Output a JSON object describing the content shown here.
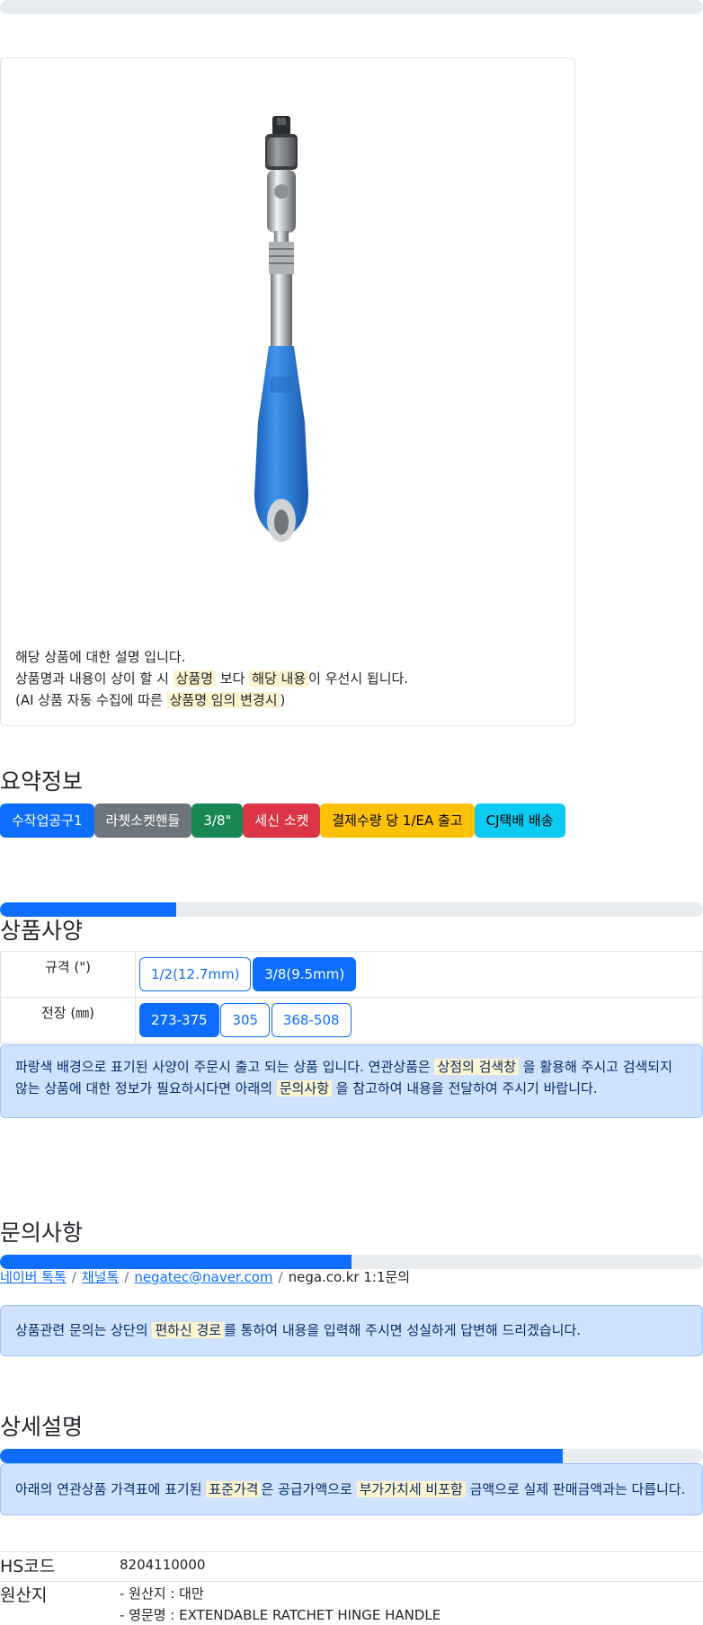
{
  "product": {
    "image_alt": "extendable ratchet hinge handle",
    "description": {
      "line1": "해당 상품에 대한 설명 입니다.",
      "line2_pre": "상품명과 내용이 상이 할 시 ",
      "line2_mark1": "상품명",
      "line2_mid": " 보다 ",
      "line2_mark2": "해당 내용",
      "line2_post": "이 우선시 됩니다.",
      "line3_pre": "(AI 상품 자동 수집에 따른 ",
      "line3_mark": "상품명 임의 변경시",
      "line3_post": ")"
    }
  },
  "summary": {
    "title": "요약정보",
    "badges": [
      {
        "label": "수작업공구1",
        "color": "#0d6efd",
        "text_color": "#ffffff"
      },
      {
        "label": "라쳇소켓핸들",
        "color": "#6c757d",
        "text_color": "#ffffff"
      },
      {
        "label": "3/8\"",
        "color": "#198754",
        "text_color": "#ffffff"
      },
      {
        "label": "세신 소켓",
        "color": "#dc3545",
        "text_color": "#ffffff"
      },
      {
        "label": "결제수량 당 1/EA 출고",
        "color": "#ffc107",
        "text_color": "#000000"
      },
      {
        "label": "CJ택배 배송",
        "color": "#0dcaf0",
        "text_color": "#000000"
      }
    ]
  },
  "spec": {
    "title": "상품사양",
    "progress": 0.25,
    "rows": [
      {
        "label": "규격 (\")",
        "options": [
          {
            "label": "1/2(12.7mm)",
            "selected": false
          },
          {
            "label": "3/8(9.5mm)",
            "selected": true
          }
        ]
      },
      {
        "label": "전장 (㎜)",
        "options": [
          {
            "label": "273-375",
            "selected": true
          },
          {
            "label": "305",
            "selected": false
          },
          {
            "label": "368-508",
            "selected": false
          }
        ]
      }
    ],
    "notice": {
      "pre": "파랑색 배경으로 표기된 사양이 주문시 출고 되는 상품 입니다. 연관상품은 ",
      "mark1": "상점의 검색창",
      "mid": " 을 활용해 주시고 검색되지 않는 상품에 대한 정보가 필요하시다면 아래의 ",
      "mark2": "문의사항",
      "post": " 을 참고하여 내용을 전달하여 주시기 바랍니다."
    }
  },
  "inquiry": {
    "title": "문의사항",
    "progress": 0.5,
    "links": {
      "naver_talk": "네이버 톡톡",
      "channel_talk": "채널톡",
      "email": "negatec@naver.com",
      "site": "nega.co.kr 1:1문의",
      "separator": "/"
    },
    "notice": {
      "pre": "상품관련 문의는 상단의 ",
      "mark": "편하신 경로",
      "post": "를 통하여 내용을 입력해 주시면 성실하게 답변해 드리겠습니다."
    }
  },
  "detail": {
    "title": "상세설명",
    "progress": 0.8,
    "notice": {
      "pre": "아래의 연관상품 가격표에 표기된 ",
      "mark1": "표준가격",
      "mid": "은 공급가액으로 ",
      "mark2": "부가가치세 비포함",
      "post": " 금액으로 실제 판매금액과는 다릅니다."
    },
    "info": [
      {
        "key": "HS코드",
        "values": [
          "8204110000"
        ]
      },
      {
        "key": "원산지",
        "values": [
          "- 원산지 : 대만",
          "- 영문명 : EXTENDABLE RATCHET HINGE HANDLE"
        ]
      }
    ]
  },
  "colors": {
    "primary": "#0d6efd",
    "alert_bg": "#cfe2ff",
    "mark_bg": "#fcf3cf",
    "track": "#e9ecef"
  }
}
